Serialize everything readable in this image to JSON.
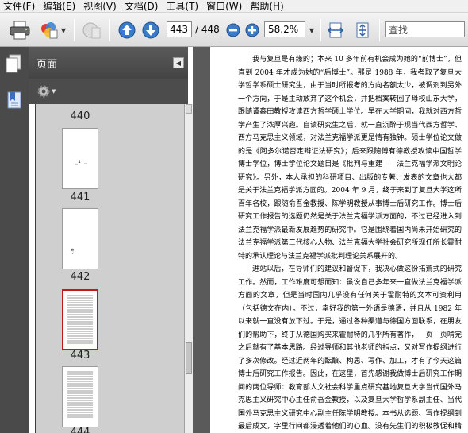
{
  "menu": [
    "文件(F)",
    "编辑(E)",
    "视图(V)",
    "文档(D)",
    "工具(T)",
    "窗口(W)",
    "帮助(H)"
  ],
  "toolbar": {
    "page_current": "443",
    "page_total": "/ 448",
    "zoom": "58.2%",
    "search_placeholder": "查找"
  },
  "nav": {
    "panel_title": "页面"
  },
  "thumbnails": [
    {
      "label": "440"
    },
    {
      "label": "441"
    },
    {
      "label": "442"
    },
    {
      "label": "443"
    },
    {
      "label": "444"
    }
  ],
  "document": {
    "paragraphs": [
      "我与复旦是有缘的；本来 10 多年前有机会成为她的“前博士”，但直到 2004 年才成为她的“后博士”。那是 1988 年，我考取了复旦大学哲学系硕士研究生，由于当时所报考的方向名额太少，被调剂到另外一个方向，于是主动放弃了这个机会，并把档案转回了母校山东大学，跟随谭鑫田教授攻读西方哲学硕士学位。早在大学期间，我就对西方哲学产生了浓厚兴趣。自读研究生之后，就一直沉醉于现当代西方哲学、西方马克思主义领域，对法兰克福学派更是情有独钟。硕士学位论文做的是《阿多尔诺否定辩证法研究》；后来跟随傅有德教授攻读中国哲学博士学位，博士学位论文题目是《批判与重建——法兰克福学派文明论研究》。另外，本人承担的科研项目、出版的专著、发表的文章也大都是关于法兰克福学派方面的。2004 年 9 月，终于来到了复旦大学这所百年名校，跟随俞吾金教授、陈学明教授从事博士后研究工作。博士后研究工作报告的选题仍然是关于法兰克福学派方面的，不过已经进入到法兰克福学派最新发展趋势的研究中。它是围绕着国内尚未开始研究的法兰克福学派第三代核心人物、法兰克福大学社会研究所现任所长霍耐特的承认理论与法兰克福学派批判理论关系展开的。",
      "进站以后，在导师们的建议和督促下，我决心做这份拓荒式的研究工作。然而，工作难度可想而知：虽说自己多年来一直做法兰克福学派方面的文章，但是当时国内几乎没有任何关于霍耐特的文本可资利用（包括德文在内）。不过，幸好我的第一外语是德语，并且从 1982 年以来就一直没有放下过。于是，通过各种渠道与德国方面联系，在朋友们的帮助下，终于从德国购买来霍耐特的几乎所有著作，一页一页啃完之后就有了基本思路。经过导师和其他老师的指点，又对写作提纲进行了多次修改。经过近两年的酝酿、构思、写作、加工，才有了今天这篇博士后研究工作报告。因此，在这里，首先感谢我做博士后研究工作期间的两位导师：教育部人文社会科学重点研究基地复旦大学当代国外马克思主义研究中心主任俞吾金教授，以及复旦大学哲学系副主任、当代国外马克思主义研究中心副主任陈学明教授。本书从选题、写作提纲到最后成文，字里行间都浸透着他们的心血。没有先生们的积极教促和精心指导，也许不会有今天这份成果。更重要的是，先生们的道德文"
    ]
  }
}
